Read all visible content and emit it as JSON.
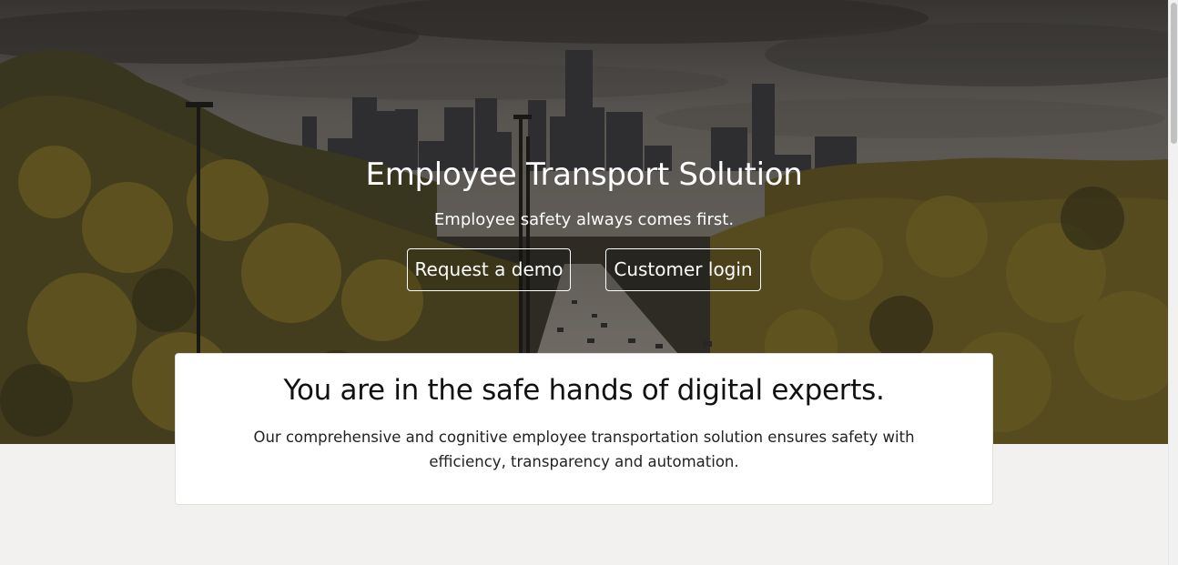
{
  "hero": {
    "title": "Employee Transport Solution",
    "subtitle": "Employee safety always comes first.",
    "buttons": {
      "demo_label": "Request a demo",
      "login_label": "Customer login"
    },
    "background_image": "city-skyline-highway-autumn-forest"
  },
  "card": {
    "title": "You are in the safe hands of digital experts.",
    "text": "Our comprehensive and cognitive employee transportation solution ensures safety with efficiency, transparency and automation."
  },
  "colors": {
    "page_background": "#f2f1ef",
    "card_background": "#ffffff",
    "hero_text": "#ffffff",
    "body_text": "#111111"
  }
}
